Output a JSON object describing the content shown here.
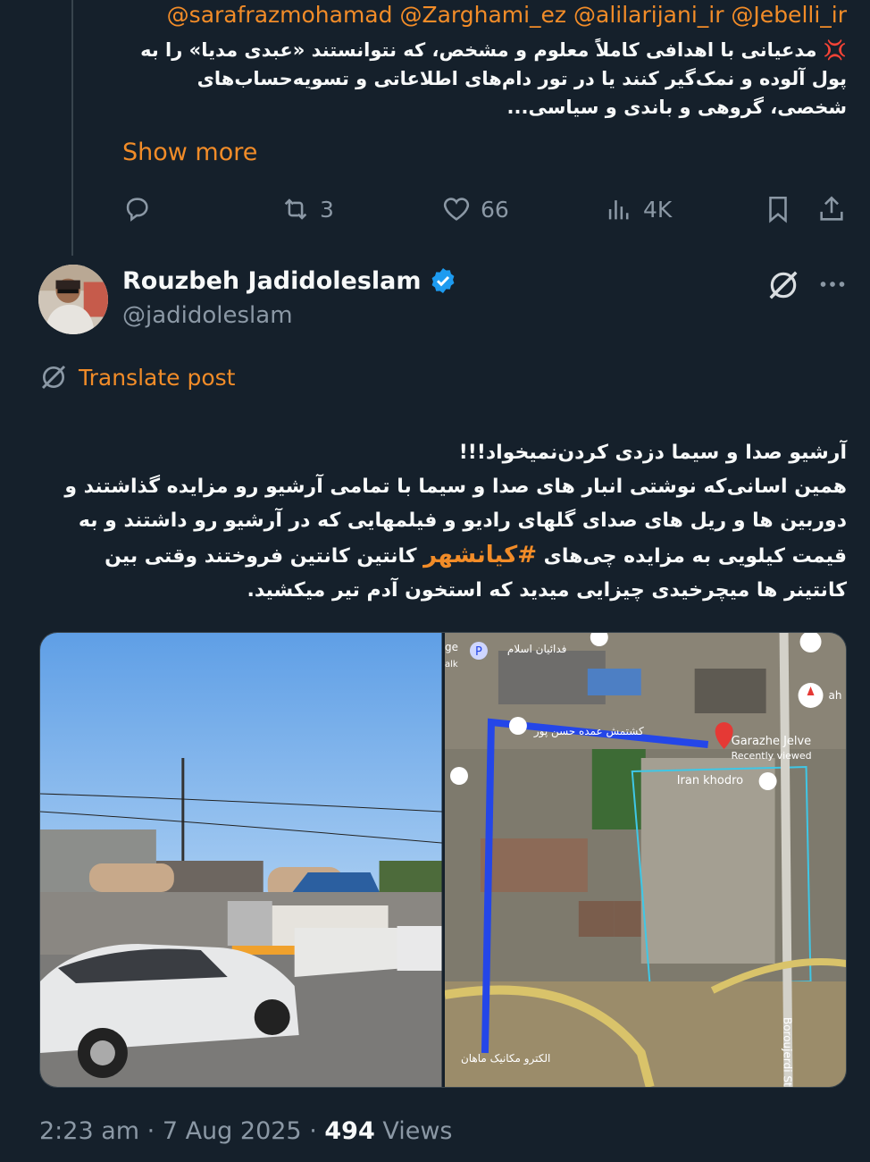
{
  "previous_post": {
    "mentions": "@sarafrazmohamad @Zarghami_ez @alilarijani_ir @Jebelli_ir",
    "emoji": "💢",
    "text": "مدعیانی با اهدافی کاملاً معلوم و مشخص، که نتوانستند «عبدی مدیا» را به پول آلوده و نمک‌گیر کنند یا در تور دام‌های اطلاعاتی و تسویه‌حساب‌های شخصی، گروهی و باندی و سیاسی...",
    "show_more": "Show more",
    "actions": {
      "replies": "",
      "reposts": "3",
      "likes": "66",
      "views": "4K"
    }
  },
  "post": {
    "author_name": "Rouzbeh Jadidoleslam",
    "handle": "@jadidoleslam",
    "translate_label": "Translate post",
    "text_before_hashtag": "آرشیو صدا و سیما دزدی کردن‌نمیخواد!!!\nهمین اسانی‌که نوشتی انبار های صدا و سیما با تمامی آرشیو رو مزایده گذاشتند و دوربین ها و ریل های صدای گلهای رادیو و فیلمهایی که در آرشیو رو داشتند و به قیمت کیلویی به مزایده چی‌های ",
    "hashtag": "#کیانشهر",
    "text_after_hashtag": " کانتین کانتین فروختند وقتی بین کانتینر ها میچرخیدی چیزایی میدید که استخون آدم تیر میکشید.",
    "map_labels": {
      "place1": "Garazhe Jelve",
      "recent": "Recently viewed",
      "place2": "Iran khodro",
      "street": "Boroujerdi St",
      "label_fa1": "فدائیان اسلام",
      "label_fa2": "کشتمش عمده حسن پور",
      "label_fa3": "الکترو مکانیک ماهان",
      "edge1": "ge",
      "edge2": "alk",
      "edge3": "ah"
    },
    "time": "2:23 am",
    "date": "7 Aug 2025",
    "views_count": "494",
    "views_label": "Views"
  },
  "colors": {
    "accent": "#f28c28",
    "background": "#15202b",
    "muted": "#8b98a5",
    "verified": "#1d9bf0"
  }
}
